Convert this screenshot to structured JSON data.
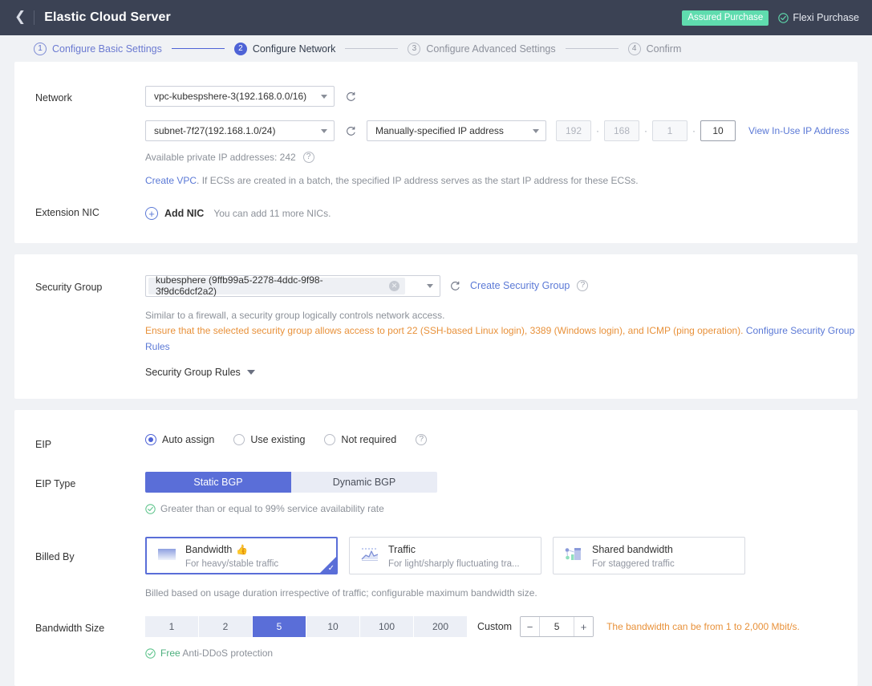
{
  "topbar": {
    "back_icon": "chevron-left-icon",
    "title": "Elastic Cloud Server",
    "assured_badge": "Assured Purchase",
    "flexi_label": "Flexi Purchase",
    "badge_color": "#5fdcae",
    "bg_color": "#3b4254"
  },
  "steps": [
    {
      "num": "1",
      "label": "Configure Basic Settings",
      "state": "done"
    },
    {
      "num": "2",
      "label": "Configure Network",
      "state": "active"
    },
    {
      "num": "3",
      "label": "Configure Advanced Settings",
      "state": "todo"
    },
    {
      "num": "4",
      "label": "Confirm",
      "state": "todo"
    }
  ],
  "network": {
    "label": "Network",
    "vpc_value": "vpc-kubespshere-3(192.168.0.0/16)",
    "subnet_value": "subnet-7f27(192.168.1.0/24)",
    "ip_mode_value": "Manually-specified IP address",
    "ip_octets": [
      "192",
      "168",
      "1",
      "10"
    ],
    "view_in_use_link": "View In-Use IP Address",
    "available_ips": "Available private IP addresses: 242",
    "create_vpc_link": "Create VPC",
    "create_vpc_note": ". If ECSs are created in a batch, the specified IP address serves as the start IP address for these ECSs.",
    "refresh_icon": "refresh-icon",
    "help_icon": "question-mark-icon"
  },
  "extension_nic": {
    "label": "Extension NIC",
    "add_nic_label": "Add NIC",
    "add_nic_hint": "You can add 11 more NICs.",
    "plus_icon": "plus-circle-icon"
  },
  "security_group": {
    "label": "Security Group",
    "chip_value": "kubesphere (9ffb99a5-2278-4ddc-9f98-3f9dc6dcf2a2)",
    "chip_close_icon": "close-circle-icon",
    "create_link": "Create Security Group",
    "desc_line1": "Similar to a firewall, a security group logically controls network access.",
    "desc_line2": "Ensure that the selected security group allows access to port 22 (SSH-based Linux login), 3389 (Windows login), and ICMP (ping operation). ",
    "configure_rules_link": "Configure Security Group Rules",
    "rules_toggle": "Security Group Rules",
    "warn_color": "#e8913a"
  },
  "eip": {
    "label": "EIP",
    "options": [
      {
        "label": "Auto assign",
        "selected": true
      },
      {
        "label": "Use existing",
        "selected": false
      },
      {
        "label": "Not required",
        "selected": false
      }
    ],
    "type_label": "EIP Type",
    "type_options": [
      {
        "label": "Static BGP",
        "selected": true
      },
      {
        "label": "Dynamic BGP",
        "selected": false
      }
    ],
    "availability_note": "Greater than or equal to 99% service availability rate",
    "accent_color": "#5a6ed8"
  },
  "billed_by": {
    "label": "Billed By",
    "cards": [
      {
        "title": "Bandwidth",
        "subtitle": "For heavy/stable traffic",
        "icon": "bandwidth-icon",
        "recommended": true,
        "selected": true
      },
      {
        "title": "Traffic",
        "subtitle": "For light/sharply fluctuating tra...",
        "icon": "traffic-chart-icon",
        "recommended": false,
        "selected": false
      },
      {
        "title": "Shared bandwidth",
        "subtitle": "For staggered traffic",
        "icon": "shared-bandwidth-icon",
        "recommended": false,
        "selected": false
      }
    ],
    "note": "Billed based on usage duration irrespective of traffic; configurable maximum bandwidth size."
  },
  "bandwidth_size": {
    "label": "Bandwidth Size",
    "options": [
      "1",
      "2",
      "5",
      "10",
      "100",
      "200"
    ],
    "selected": "5",
    "custom_label": "Custom",
    "custom_value": "5",
    "minus_icon": "minus-icon",
    "plus_icon": "plus-icon",
    "range_warning": "The bandwidth can be from 1 to 2,000 Mbit/s.",
    "ddos_free_word": "Free",
    "ddos_note": " Anti-DDoS protection"
  }
}
